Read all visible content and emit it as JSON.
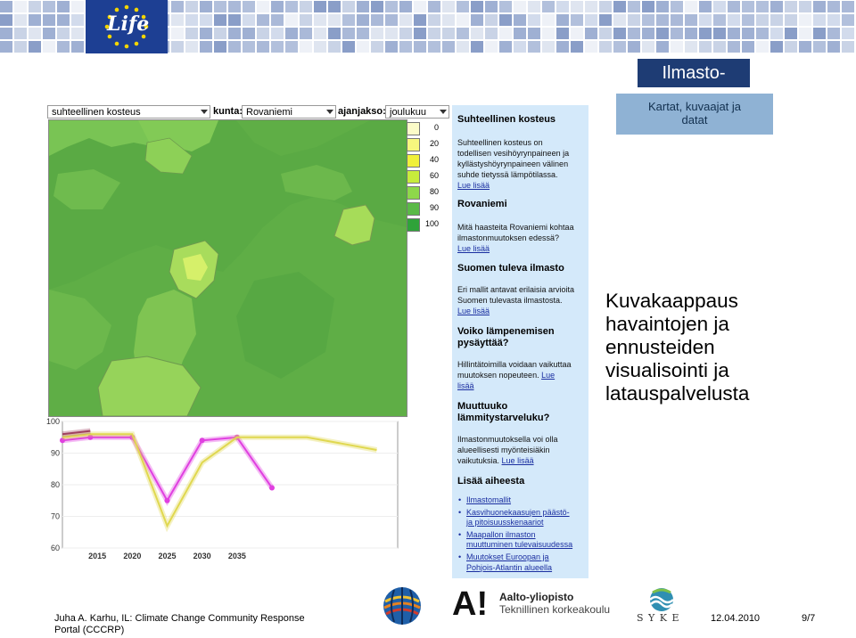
{
  "header": {
    "logo_text": "Life"
  },
  "brand": {
    "title": "Ilmasto-opas.fi",
    "subtitle_line1": "Kartat, kuvaajat ja",
    "subtitle_line2": "datat"
  },
  "controls": {
    "variable_value": "suhteellinen kosteus",
    "municipality_label": "kunta:",
    "municipality_value": "Rovaniemi",
    "period_label": "ajanjakso:",
    "period_value": "joulukuu"
  },
  "legend": {
    "items": [
      {
        "label": "0",
        "color": "#fbfbc8"
      },
      {
        "label": "20",
        "color": "#f7f77e"
      },
      {
        "label": "40",
        "color": "#f0f03a"
      },
      {
        "label": "60",
        "color": "#c7ec3c"
      },
      {
        "label": "80",
        "color": "#8ed84a"
      },
      {
        "label": "90",
        "color": "#5ab947"
      },
      {
        "label": "100",
        "color": "#2fa33a"
      }
    ]
  },
  "chart_data": {
    "type": "line",
    "x_ticks": [
      "2015",
      "2020",
      "2025",
      "2030",
      "2035"
    ],
    "y_ticks": [
      "100",
      "90",
      "80",
      "70",
      "60"
    ],
    "ylim": [
      60,
      100
    ],
    "xlim": [
      2010,
      2058
    ],
    "series": [
      {
        "color": "#e040e0",
        "x": [
          2010,
          2014,
          2020,
          2025,
          2030,
          2035,
          2040
        ],
        "y": [
          94,
          95,
          95,
          75,
          94,
          95,
          79
        ]
      },
      {
        "color": "#e0d850",
        "x": [
          2010,
          2014,
          2020,
          2025,
          2030,
          2035,
          2040,
          2045,
          2050,
          2055
        ],
        "y": [
          95,
          96,
          96,
          67,
          87,
          95,
          95,
          95,
          93,
          91
        ]
      },
      {
        "color": "#a04060",
        "x": [
          2010,
          2014
        ],
        "y": [
          96,
          97
        ]
      }
    ]
  },
  "info": {
    "s1_title": "Suhteellinen kosteus",
    "s1_line1": "Suhteellinen kosteus on",
    "s1_line2": "todellisen vesihöyrynpaineen ja",
    "s1_line3": "kyllästyshöyrynpaineen välinen",
    "s1_line4": "suhde tietyssä lämpötilassa.",
    "s1_link": "Lue lisää",
    "s2_title": "Rovaniemi",
    "s2_line1": "Mitä haasteita Rovaniemi kohtaa",
    "s2_line2": "ilmastonmuutoksen edessä?",
    "s2_link": "Lue lisää",
    "s3_title": "Suomen tuleva ilmasto",
    "s3_line1": "Eri mallit antavat erilaisia arvioita",
    "s3_line2": "Suomen tulevasta ilmastosta.",
    "s3_link": "Lue lisää",
    "s4_title_line1": "Voiko lämpenemisen",
    "s4_title_line2": "pysäyttää?",
    "s4_line1": "Hillintätoimilla voidaan vaikuttaa",
    "s4_line2": "muutoksen nopeuteen.",
    "s4_link_part1": "Lue",
    "s4_link_part2": "lisää",
    "s5_title_line1": "Muuttuuko",
    "s5_title_line2": "lämmitystarveluku?",
    "s5_line1": "Ilmastonmuutoksella voi olla",
    "s5_line2": "alueellisesti myönteisiäkin",
    "s5_line3": "vaikutuksia.",
    "s5_link": "Lue lisää",
    "s6_title": "Lisää aiheesta",
    "links": [
      {
        "line1": "Ilmastomallit",
        "line2": ""
      },
      {
        "line1": "Kasvihuonekaasujen päästö-",
        "line2": "ja pitoisuusskenaariot"
      },
      {
        "line1": "Maapallon ilmaston",
        "line2": "muuttuminen tulevaisuudessa"
      },
      {
        "line1": "Muutokset Euroopan ja",
        "line2": "Pohjois-Atlantin alueella"
      }
    ]
  },
  "caption": {
    "line1": "Kuvakaappaus",
    "line2": "havaintojen ja",
    "line3": "ennusteiden",
    "line4": "visualisointi ja",
    "line5": "latauspalvelusta"
  },
  "footer": {
    "line1": "Juha A. Karhu, IL: Climate Change Community Response",
    "line2": "Portal (CCCRP)",
    "date": "12.04.2010",
    "page": "9/7"
  },
  "logos": {
    "aalto_line1": "Aalto-yliopisto",
    "aalto_line2": "Teknillinen korkeakoulu",
    "aalto_mark": "A!",
    "syke_text": "S Y K E"
  }
}
